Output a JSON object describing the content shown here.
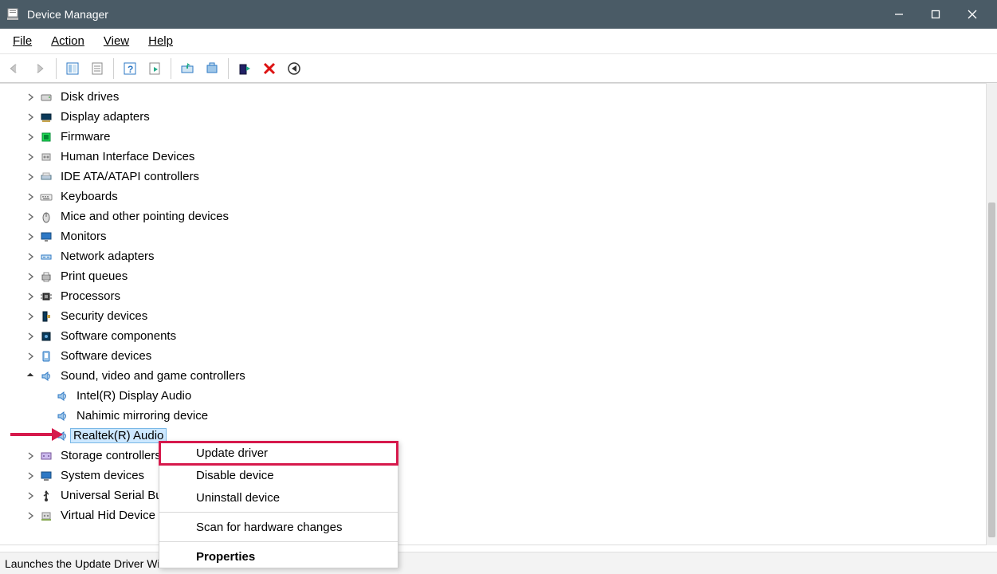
{
  "window": {
    "title": "Device Manager"
  },
  "menubar": [
    "File",
    "Action",
    "View",
    "Help"
  ],
  "statusbar": "Launches the Update Driver Wizard for the selected device.",
  "tree": [
    {
      "label": "Disk drives",
      "icon": "disk-icon",
      "expandable": true
    },
    {
      "label": "Display adapters",
      "icon": "display-adapter-icon",
      "expandable": true
    },
    {
      "label": "Firmware",
      "icon": "firmware-icon",
      "expandable": true
    },
    {
      "label": "Human Interface Devices",
      "icon": "hid-icon",
      "expandable": true
    },
    {
      "label": "IDE ATA/ATAPI controllers",
      "icon": "ide-icon",
      "expandable": true
    },
    {
      "label": "Keyboards",
      "icon": "keyboard-icon",
      "expandable": true
    },
    {
      "label": "Mice and other pointing devices",
      "icon": "mouse-icon",
      "expandable": true
    },
    {
      "label": "Monitors",
      "icon": "monitor-icon",
      "expandable": true
    },
    {
      "label": "Network adapters",
      "icon": "network-icon",
      "expandable": true
    },
    {
      "label": "Print queues",
      "icon": "printer-icon",
      "expandable": true
    },
    {
      "label": "Processors",
      "icon": "processor-icon",
      "expandable": true
    },
    {
      "label": "Security devices",
      "icon": "security-icon",
      "expandable": true
    },
    {
      "label": "Software components",
      "icon": "component-icon",
      "expandable": true
    },
    {
      "label": "Software devices",
      "icon": "software-device-icon",
      "expandable": true
    },
    {
      "label": "Sound, video and game controllers",
      "icon": "sound-icon",
      "expandable": true,
      "expanded": true,
      "children": [
        {
          "label": "Intel(R) Display Audio",
          "icon": "sound-icon"
        },
        {
          "label": "Nahimic mirroring device",
          "icon": "sound-icon"
        },
        {
          "label": "Realtek(R) Audio",
          "icon": "sound-icon",
          "selected": true
        }
      ]
    },
    {
      "label": "Storage controllers",
      "icon": "storage-ctrl-icon",
      "expandable": true
    },
    {
      "label": "System devices",
      "icon": "system-icon",
      "expandable": true
    },
    {
      "label": "Universal Serial Bus controllers",
      "icon": "usb-icon",
      "expandable": true
    },
    {
      "label": "Virtual Hid Device Service",
      "icon": "vhid-icon",
      "expandable": true
    }
  ],
  "context_menu": [
    {
      "label": "Update driver",
      "highlighted": true
    },
    {
      "label": "Disable device"
    },
    {
      "label": "Uninstall device"
    },
    {
      "sep": true
    },
    {
      "label": "Scan for hardware changes"
    },
    {
      "sep": true
    },
    {
      "label": "Properties",
      "bold": true
    }
  ]
}
